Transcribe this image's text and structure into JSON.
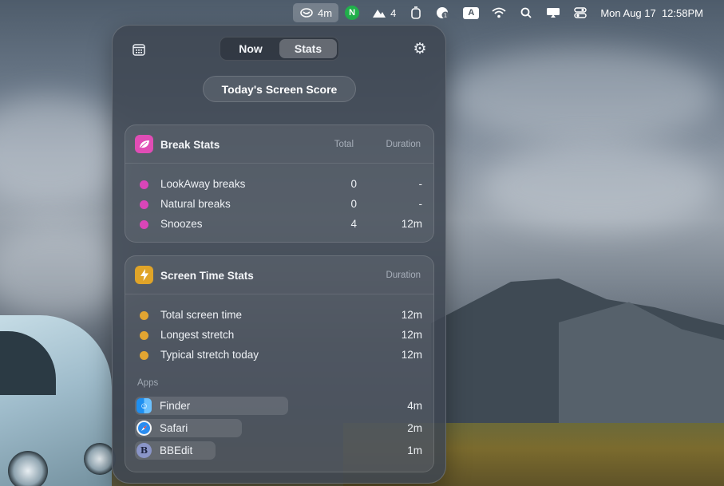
{
  "menubar": {
    "lookaway_time": "4m",
    "n_label": "N",
    "climb_count": "4",
    "a_label": "A",
    "datetime": "Mon Aug 17  12:58PM"
  },
  "tabs": [
    {
      "label": "Now",
      "selected": false
    },
    {
      "label": "Stats",
      "selected": true
    }
  ],
  "score_button": "Today's Screen Score",
  "break_stats": {
    "title": "Break Stats",
    "col_total": "Total",
    "col_duration": "Duration",
    "rows": [
      {
        "label": "LookAway breaks",
        "total": "0",
        "duration": "-"
      },
      {
        "label": "Natural breaks",
        "total": "0",
        "duration": "-"
      },
      {
        "label": "Snoozes",
        "total": "4",
        "duration": "12m"
      }
    ]
  },
  "screen_time_stats": {
    "title": "Screen Time Stats",
    "col_duration": "Duration",
    "rows": [
      {
        "label": "Total screen time",
        "duration": "12m"
      },
      {
        "label": "Longest stretch",
        "duration": "12m"
      },
      {
        "label": "Typical stretch today",
        "duration": "12m"
      }
    ],
    "apps_label": "Apps",
    "apps": [
      {
        "name": "Finder",
        "duration": "4m",
        "share": 0.33,
        "icon": "finder-icon"
      },
      {
        "name": "Safari",
        "duration": "2m",
        "share": 0.17,
        "icon": "safari-icon"
      },
      {
        "name": "BBEdit",
        "duration": "1m",
        "share": 0.08,
        "icon": "bbedit-icon"
      }
    ]
  },
  "colors": {
    "break_dot": "#d946b8",
    "screen_dot": "#e2a532",
    "break_icon": "#e04db5",
    "screen_icon": "#e0a428"
  }
}
